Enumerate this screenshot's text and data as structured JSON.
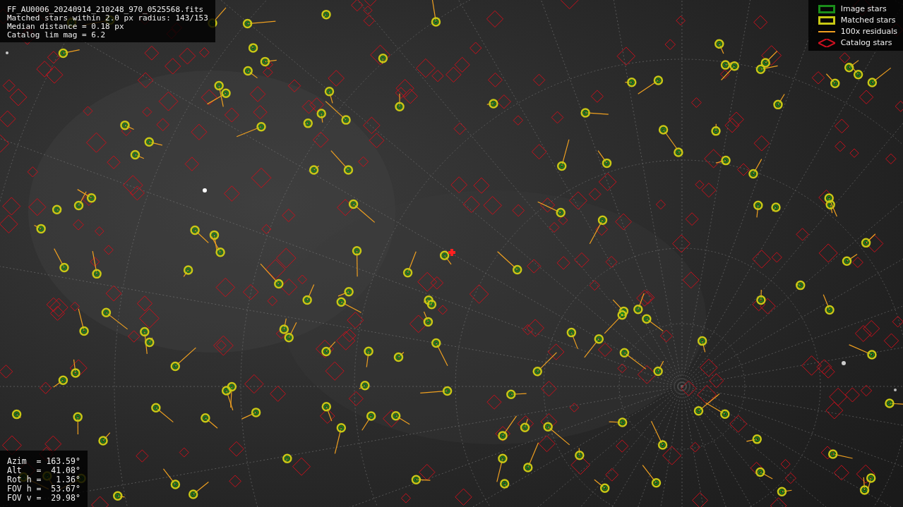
{
  "info": {
    "lines": [
      "FF_AU0006_20240914_210248_970_0525568.fits",
      "Matched stars within 2.0 px radius: 143/153",
      "Median distance = 0.18 px",
      "Catalog lim mag = 6.2"
    ]
  },
  "legend": [
    {
      "kind": "box",
      "label": "Image stars",
      "color": "#1a8c1a"
    },
    {
      "kind": "box",
      "label": "Matched stars",
      "color": "#c8c814"
    },
    {
      "kind": "line",
      "label": "100x residuals",
      "color": "#f0a020"
    },
    {
      "kind": "diamond",
      "label": "Catalog stars",
      "color": "#d01020"
    }
  ],
  "pointing": {
    "lines": [
      "Azim  = 163.59°",
      "Alt   =  41.08°",
      "Rot h =   1.36°",
      "FOV h =  53.67°",
      "FOV v =  29.98°"
    ]
  }
}
